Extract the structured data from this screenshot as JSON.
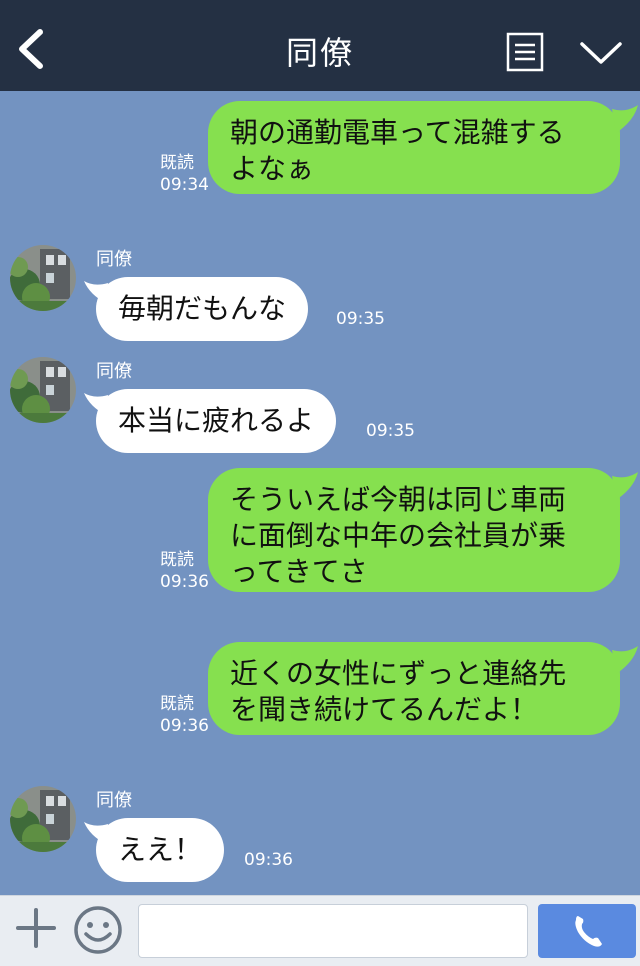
{
  "header": {
    "title": "同僚",
    "back_icon": "chevron-left-icon",
    "note_icon": "note-icon",
    "menu_icon": "chevron-down-icon"
  },
  "colors": {
    "header_bg": "#243043",
    "chat_bg": "#7393c1",
    "outgoing_bubble": "#86e04f",
    "incoming_bubble": "#ffffff",
    "call_button": "#5a8ae0"
  },
  "messages": [
    {
      "direction": "out",
      "text": "朝の通勤電車って混雑する\nよなぁ",
      "read": "既読",
      "time": "09:34"
    },
    {
      "direction": "in",
      "sender": "同僚",
      "text": "毎朝だもんな",
      "time": "09:35"
    },
    {
      "direction": "in",
      "sender": "同僚",
      "text": "本当に疲れるよ",
      "time": "09:35"
    },
    {
      "direction": "out",
      "text": "そういえば今朝は同じ車両\nに面倒な中年の会社員が乗\nってきてさ",
      "read": "既読",
      "time": "09:36"
    },
    {
      "direction": "out",
      "text": "近くの女性にずっと連絡先\nを聞き続けてるんだよ！",
      "read": "既読",
      "time": "09:36"
    },
    {
      "direction": "in",
      "sender": "同僚",
      "text": "ええ！",
      "time": "09:36"
    }
  ],
  "footer": {
    "plus_icon": "plus-icon",
    "sticker_icon": "smiley-icon",
    "input_value": "",
    "input_placeholder": "",
    "call_icon": "phone-icon"
  }
}
